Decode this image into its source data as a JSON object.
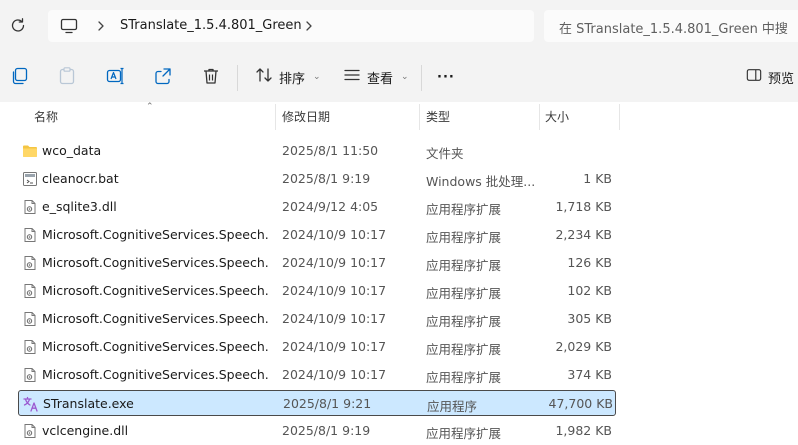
{
  "address_bar": {
    "breadcrumb": "STranslate_1.5.4.801_Green",
    "search_placeholder": "在 STranslate_1.5.4.801_Green 中搜"
  },
  "toolbar": {
    "sort_label": "排序",
    "view_label": "查看",
    "more_label": "···",
    "preview_label": "预览"
  },
  "columns": {
    "name": "名称",
    "date": "修改日期",
    "type": "类型",
    "size": "大小"
  },
  "files": [
    {
      "name": "wco_data",
      "date": "2025/8/1 11:50",
      "type": "文件夹",
      "size": "",
      "icon": "folder-icon"
    },
    {
      "name": "cleanocr.bat",
      "date": "2025/8/1 9:19",
      "type": "Windows 批处理...",
      "size": "1 KB",
      "icon": "batch-file-icon"
    },
    {
      "name": "e_sqlite3.dll",
      "date": "2024/9/12 4:05",
      "type": "应用程序扩展",
      "size": "1,718 KB",
      "icon": "dll-file-icon"
    },
    {
      "name": "Microsoft.CognitiveServices.Speech.c...",
      "date": "2024/10/9 10:17",
      "type": "应用程序扩展",
      "size": "2,234 KB",
      "icon": "dll-file-icon"
    },
    {
      "name": "Microsoft.CognitiveServices.Speech.e...",
      "date": "2024/10/9 10:17",
      "type": "应用程序扩展",
      "size": "126 KB",
      "icon": "dll-file-icon"
    },
    {
      "name": "Microsoft.CognitiveServices.Speech.e...",
      "date": "2024/10/9 10:17",
      "type": "应用程序扩展",
      "size": "102 KB",
      "icon": "dll-file-icon"
    },
    {
      "name": "Microsoft.CognitiveServices.Speech.e...",
      "date": "2024/10/9 10:17",
      "type": "应用程序扩展",
      "size": "305 KB",
      "icon": "dll-file-icon"
    },
    {
      "name": "Microsoft.CognitiveServices.Speech.e...",
      "date": "2024/10/9 10:17",
      "type": "应用程序扩展",
      "size": "2,029 KB",
      "icon": "dll-file-icon"
    },
    {
      "name": "Microsoft.CognitiveServices.Speech.e...",
      "date": "2024/10/9 10:17",
      "type": "应用程序扩展",
      "size": "374 KB",
      "icon": "dll-file-icon"
    },
    {
      "name": "STranslate.exe",
      "date": "2025/8/1 9:21",
      "type": "应用程序",
      "size": "47,700 KB",
      "icon": "translate-app-icon",
      "selected": true
    },
    {
      "name": "vclcengine.dll",
      "date": "2025/8/1 9:19",
      "type": "应用程序扩展",
      "size": "1,982 KB",
      "icon": "dll-file-icon"
    }
  ],
  "colors": {
    "selected_bg": "#cce8ff",
    "folder": "#f4c542",
    "accent": "#0067c0"
  }
}
